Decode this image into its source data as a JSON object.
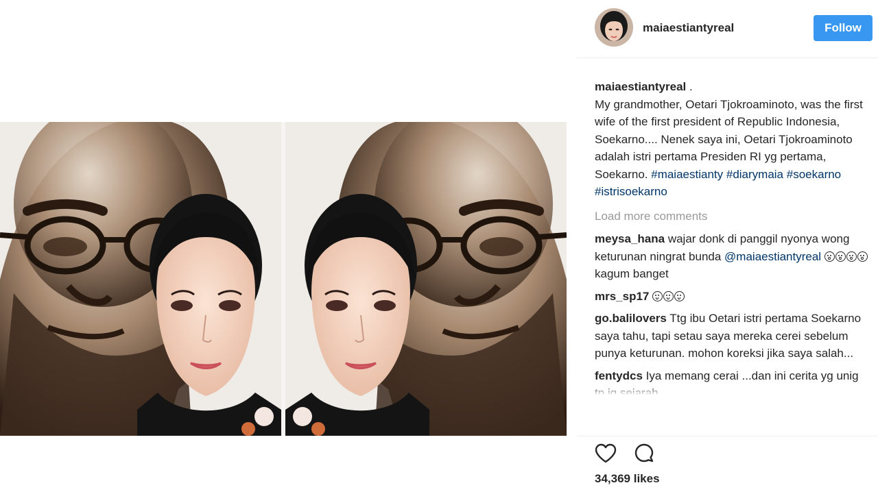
{
  "post": {
    "username": "maiaestiantyreal",
    "follow_label": "Follow",
    "caption_username": "maiaestiantyreal",
    "caption_dot": " .",
    "caption_text": "My grandmother, Oetari Tjokroaminoto, was the first wife of the first president of Republic Indonesia, Soekarno.... Nenek saya ini, Oetari Tjokroaminoto adalah istri pertama Presiden RI yg pertama, Soekarno.",
    "hashtags": [
      "#maiaestianty",
      "#diarymaia",
      "#soekarno",
      "#istrisoekarno"
    ],
    "load_more": "Load more comments",
    "likes": "34,369 likes"
  },
  "comments": [
    {
      "username": "meysa_hana",
      "text_before": "wajar donk di panggil nyonya wong keturunan ningrat bunda",
      "mention": "@maiaestiantyreal",
      "emoji_count": 4,
      "text_after": "kagum banget"
    },
    {
      "username": "mrs_sp17",
      "emoji_count": 3
    },
    {
      "username": "go.balilovers",
      "text": "Ttg ibu Oetari istri pertama Soekarno saya tahu, tapi setau saya mereka cerei sebelum punya keturunan. mohon koreksi jika saya salah..."
    },
    {
      "username": "fentydcs",
      "text": "Iya memang cerai ...dan ini cerita yg unig tp jg sejarah"
    }
  ],
  "icons": {
    "like": "heart-icon",
    "comment": "speech-bubble-icon"
  },
  "colors": {
    "follow_button": "#3897f0",
    "link": "#003569",
    "muted": "#999999",
    "text": "#262626"
  }
}
